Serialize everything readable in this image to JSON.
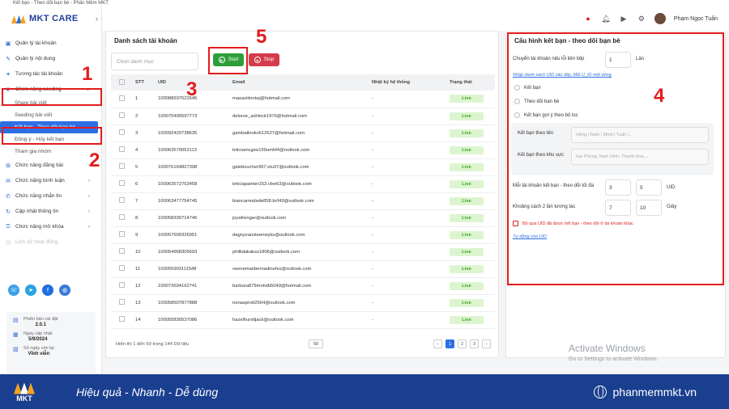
{
  "window_title": "Kết bạn - Theo dõi bạn bè - Phần Mềm MKT",
  "app": {
    "logo_text": "MKT CARE",
    "collapse": "‹"
  },
  "sidebar": {
    "items": [
      {
        "label": "Quản lý tài khoản"
      },
      {
        "label": "Quản lý nội dung"
      },
      {
        "label": "Tương tác tài khoản"
      },
      {
        "label": "Chức năng seeding"
      },
      {
        "label": "Share bài viết"
      },
      {
        "label": "Seeding bài viết"
      },
      {
        "label": "Kết bạn - Theo dõi bạn bè"
      },
      {
        "label": "Đồng ý - Hủy kết bạn"
      },
      {
        "label": "Tham gia nhóm"
      },
      {
        "label": "Chức năng đăng bài"
      },
      {
        "label": "Chức năng bình luận"
      },
      {
        "label": "Chức năng nhắn tin"
      },
      {
        "label": "Cập nhật thông tin"
      },
      {
        "label": "Chức năng mở khóa"
      },
      {
        "label": "Lịch sử hoạt động"
      }
    ],
    "info": {
      "version_label": "Phiên bản cài đặt",
      "version": "2.0.1",
      "update_label": "Ngày cập nhật",
      "update_date": "5/9/2024",
      "days_label": "Số ngày còn lại",
      "days": "Vĩnh viễn"
    }
  },
  "topbar": {
    "username": "Phạm Ngọc Tuấn"
  },
  "accounts": {
    "title": "Danh sách tài khoản",
    "select_placeholder": "Chọn danh mục",
    "start": "Start",
    "stop": "Stop",
    "columns": [
      "STT",
      "UID",
      "Email",
      "Nhật ký hệ thống",
      "Trạng thái"
    ],
    "rows": [
      {
        "stt": "1",
        "uid": "100088937622645",
        "email": "masaviitontej@hotmail.com",
        "log": "-",
        "status": "Live"
      },
      {
        "stt": "2",
        "uid": "100075499597773",
        "email": "delorse_ashlock1976@hotmail.com",
        "log": "-",
        "status": "Live"
      },
      {
        "stt": "3",
        "uid": "100092420738635",
        "email": "gamballookv612627@hotmail.com",
        "log": "-",
        "status": "Live"
      },
      {
        "stt": "4",
        "uid": "100063579062113",
        "email": "leticiamcgee159umhf4@outlook.com",
        "log": "-",
        "status": "Live"
      },
      {
        "stt": "5",
        "uid": "100076164827398",
        "email": "galeboucher997.olu37@outlook.com",
        "log": "-",
        "status": "Live"
      },
      {
        "stt": "6",
        "uid": "100063572702458",
        "email": "leticiapainter153.vlxe63@outlook.com",
        "log": "-",
        "status": "Live"
      },
      {
        "stt": "7",
        "uid": "100063477754745",
        "email": "biancamodade858.bcf43@outlook.com",
        "log": "-",
        "status": "Live"
      },
      {
        "stt": "8",
        "uid": "100058330714746",
        "email": "joyafrenger@outlook.com",
        "log": "-",
        "status": "Live"
      },
      {
        "stt": "9",
        "uid": "100057609326951",
        "email": "dagnyvansteenwyks@outlook.com",
        "log": "-",
        "status": "Live"
      },
      {
        "stt": "10",
        "uid": "100054968305693",
        "email": "phillidakakss1806@outlook.com",
        "log": "-",
        "status": "Live"
      },
      {
        "stt": "11",
        "uid": "100055903111548",
        "email": "veenemanbernadinefxs@outlook.com",
        "log": "-",
        "status": "Live"
      },
      {
        "stt": "12",
        "uid": "100073694162741",
        "email": "barbara879mntvtb5049@hotmail.com",
        "log": "-",
        "status": "Live"
      },
      {
        "stt": "13",
        "uid": "100058507877888",
        "email": "nonasprott2564@outlook.com",
        "log": "-",
        "status": "Live"
      },
      {
        "stt": "14",
        "uid": "100055830537086",
        "email": "hazelhurstljack@outlook.com",
        "log": "-",
        "status": "Live"
      }
    ],
    "footer": "Hiển thị 1 đến 50 trong 144 Dữ liệu",
    "page_size": "50",
    "pages": [
      "‹",
      "1",
      "2",
      "3",
      "›"
    ]
  },
  "config": {
    "title": "Cấu hình kết bạn - theo dõi bạn bè",
    "switch_label": "Chuyển tài khoản nếu lỗi liên tiếp",
    "switch_value": "1",
    "switch_unit": "Lần",
    "uid_link": "Nhập danh sách UID vào đây, Mỗi U_ID một dòng",
    "opt1": "Kết bạn",
    "opt2": "Theo dõi bạn bè",
    "opt3": "Kết bạn gợi ý theo bộ lọc",
    "name_label": "Kết bạn theo tên",
    "name_ph": "Hồng | Nam | Minh | Tuấn |...",
    "area_label": "Kết bạn theo khu vực",
    "area_ph": "Hai Phong, Nam Dinh, Thanh Hoa,...",
    "max_label": "Mỗi tài khoản kết bạn - theo dõi tối đa",
    "max_min": "3",
    "max_max": "5",
    "max_unit": "UID",
    "gap_label": "Khoảng cách 2 lần tương tác",
    "gap_min": "7",
    "gap_max": "10",
    "gap_unit": "Giây",
    "skip_label": "Bỏ qua UID đã được kết bạn - theo dõi ở tài khoản khác",
    "auto_link": "Tự động xóa UID"
  },
  "annotations": [
    "1",
    "2",
    "3",
    "4",
    "5"
  ],
  "watermark": {
    "line1": "Activate Windows",
    "line2": "Go to Settings to activate Windows."
  },
  "banner": {
    "logo": "MKT",
    "slogan": "Hiệu quả - Nhanh - Dễ dùng",
    "site": "phanmemmkt.vn"
  }
}
